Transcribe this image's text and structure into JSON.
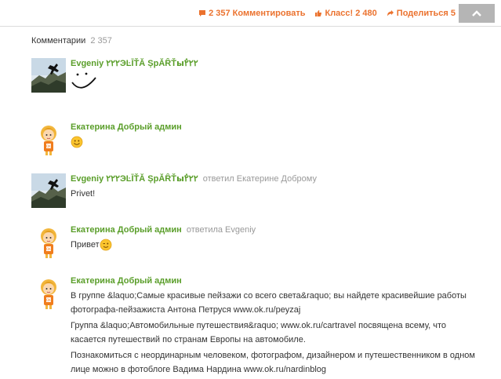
{
  "topbar": {
    "comments_label": "2 357 Комментировать",
    "class_label": "Класс! 2 480",
    "share_label": "Поделиться 5",
    "colors": {
      "accent": "#eb722e",
      "scroll_button": "#b5b5b5"
    }
  },
  "comments_section": {
    "title": "Комментарии",
    "count": "2 357"
  },
  "colors": {
    "author": "#5a9e2a",
    "muted": "#999999",
    "text": "#333333"
  },
  "comments": [
    {
      "author": "Evgeniy ۲۲۲ЭĿĪŤĂ ȘрĂȒŤыٌ۲۲۲",
      "reply_to": "",
      "avatar": "photo-avatar",
      "paragraphs": [],
      "emoticon": "drawn-smile-icon"
    },
    {
      "author": "Екатерина Добрый админ",
      "reply_to": "",
      "avatar": "cartoon-girl-avatar",
      "paragraphs": [],
      "emoticon": "smiley-icon"
    },
    {
      "author": "Evgeniy ۲۲۲ЭĿĪŤĂ ȘрĂȒŤыٌ۲۲۲",
      "reply_to": "ответил Екатерине Доброму",
      "avatar": "photo-avatar",
      "paragraphs": [
        "Privet!"
      ]
    },
    {
      "author": "Екатерина Добрый админ",
      "reply_to": "ответила Evgeniy",
      "avatar": "cartoon-girl-avatar",
      "paragraphs": [
        "Привет"
      ],
      "emoticon": "wink-icon"
    },
    {
      "author": "Екатерина Добрый админ",
      "reply_to": "",
      "avatar": "cartoon-girl-avatar",
      "paragraphs": [
        "В группе &laquo;Самые красивые пейзажи со всего света&raquo; вы найдете красивейшие работы фотографа-пейзажиста Антона Петруся www.ok.ru/peyzaj",
        "Группа &laquo;Автомобильные путешествия&raquo; www.ok.ru/cartravel посвящена всему, что касается путешествий по странам Европы на автомобиле.",
        "Познакомиться с неординарным человеком, фотографом, дизайнером и путешественником в одном лице можно в фотоблоге Вадима Нардина www.ok.ru/nardinblog"
      ]
    }
  ]
}
